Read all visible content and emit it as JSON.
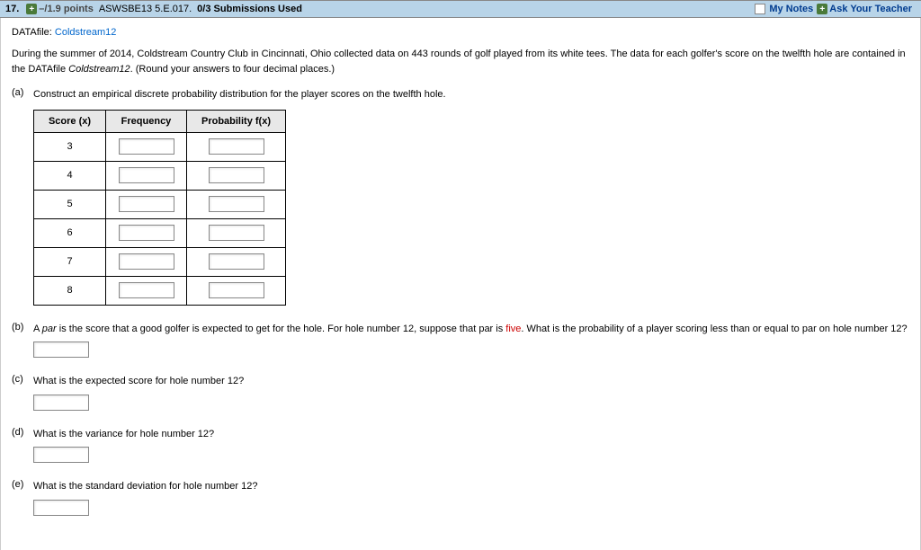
{
  "header": {
    "question_number": "17.",
    "points": "–/1.9 points",
    "reference": "ASWSBE13 5.E.017.",
    "submissions": "0/3 Submissions Used",
    "my_notes": "My Notes",
    "ask_teacher": "Ask Your Teacher"
  },
  "datafile": {
    "label": "DATAfile: ",
    "name": "Coldstream12"
  },
  "intro": {
    "text1": "During the summer of 2014, Coldstream Country Club in Cincinnati, Ohio collected data on 443 rounds of golf played from its white tees. The data for each golfer's score on the twelfth hole are contained in the DATAfile ",
    "italic": "Coldstream12",
    "text2": ". (Round your answers to four decimal places.)"
  },
  "parts": {
    "a": {
      "label": "(a)",
      "text": "Construct an empirical discrete probability distribution for the player scores on the twelfth hole."
    },
    "b": {
      "label": "(b)",
      "text1": "A ",
      "italic": "par",
      "text2": " is the score that a good golfer is expected to get for the hole. For hole number 12, suppose that par is ",
      "red": "five",
      "text3": ". What is the probability of a player scoring less than or equal to par on hole number 12?"
    },
    "c": {
      "label": "(c)",
      "text": "What is the expected score for hole number 12?"
    },
    "d": {
      "label": "(d)",
      "text": "What is the variance for hole number 12?"
    },
    "e": {
      "label": "(e)",
      "text": "What is the standard deviation for hole number 12?"
    }
  },
  "table": {
    "headers": {
      "score": "Score (x)",
      "freq": "Frequency",
      "prob": "Probability f(x)"
    },
    "scores": [
      "3",
      "4",
      "5",
      "6",
      "7",
      "8"
    ]
  }
}
